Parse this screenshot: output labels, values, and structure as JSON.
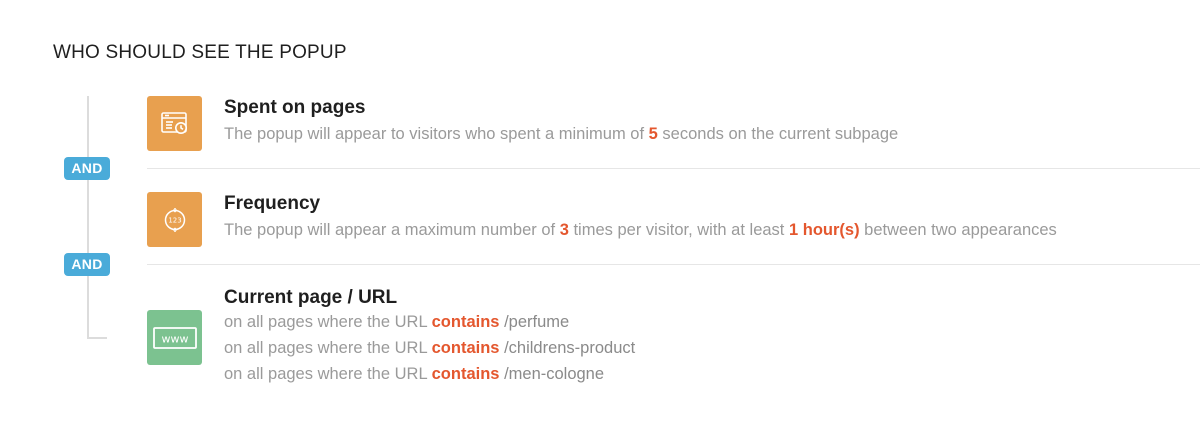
{
  "section": {
    "title": "WHO SHOULD SEE THE POPUP"
  },
  "connectors": [
    "AND",
    "AND"
  ],
  "rules": {
    "spent": {
      "icon": "browser-clock-icon",
      "title": "Spent on pages",
      "desc_pre": "The popup will appear to visitors who spent a minimum of",
      "seconds": "5",
      "desc_post": "seconds on the current subpage"
    },
    "frequency": {
      "icon": "counter-cycle-icon",
      "title": "Frequency",
      "desc_pre": "The popup will appear a maximum number of",
      "times": "3",
      "desc_mid": "times per visitor, with at least",
      "interval": "1 hour(s)",
      "desc_post": "between two appearances"
    },
    "url": {
      "icon": "www-icon",
      "icon_text": "www",
      "title": "Current page / URL",
      "lines": [
        {
          "pre": "on all pages where the URL",
          "op": "contains",
          "value": "/perfume"
        },
        {
          "pre": "on all pages where the URL",
          "op": "contains",
          "value": "/childrens-product"
        },
        {
          "pre": "on all pages where the URL",
          "op": "contains",
          "value": "/men-cologne"
        }
      ]
    }
  },
  "colors": {
    "accent_orange": "#e8a04f",
    "accent_green": "#7cc290",
    "badge_blue": "#4aabd9",
    "highlight": "#e4572e"
  }
}
